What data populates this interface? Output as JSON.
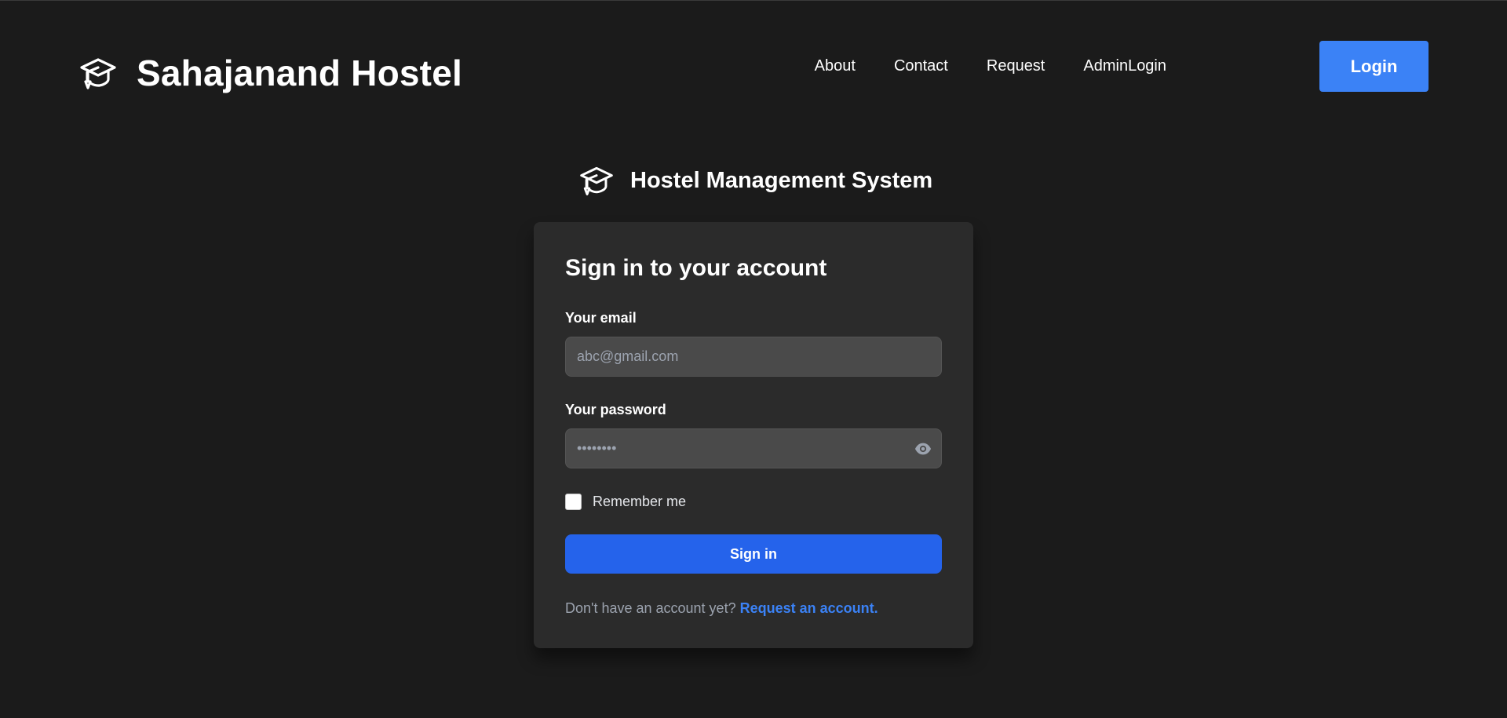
{
  "header": {
    "brand_title": "Sahajanand Hostel",
    "brand_icon": "graduation-cap-icon",
    "nav": [
      {
        "label": "About"
      },
      {
        "label": "Contact"
      },
      {
        "label": "Request"
      },
      {
        "label": "AdminLogin"
      }
    ],
    "login_label": "Login"
  },
  "system": {
    "title": "Hostel Management System",
    "icon": "graduation-cap-icon"
  },
  "form": {
    "heading": "Sign in to your account",
    "email_label": "Your email",
    "email_placeholder": "abc@gmail.com",
    "email_value": "",
    "password_label": "Your password",
    "password_placeholder": "••••••••",
    "password_value": "",
    "remember_label": "Remember me",
    "remember_checked": false,
    "signin_label": "Sign in",
    "footer_prompt": "Don't have an account yet? ",
    "footer_link": "Request an account."
  },
  "colors": {
    "background": "#1b1b1b",
    "card": "#2b2b2b",
    "accent": "#3b82f6",
    "signin": "#2563eb"
  }
}
